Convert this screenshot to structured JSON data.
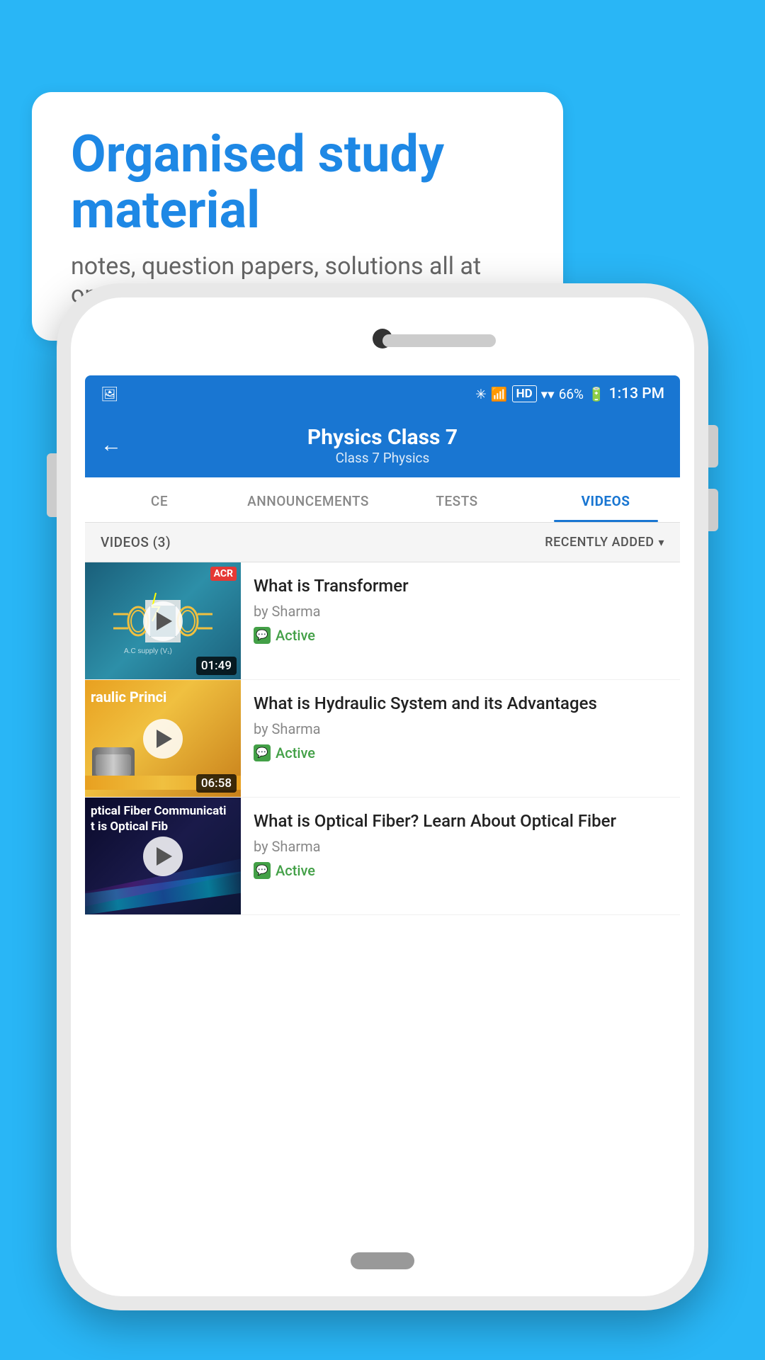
{
  "bubble": {
    "title": "Organised study material",
    "subtitle": "notes, question papers, solutions all at one place"
  },
  "statusBar": {
    "time": "1:13 PM",
    "battery": "66%",
    "signal": "HD"
  },
  "header": {
    "title": "Physics Class 7",
    "breadcrumb": "Class 7   Physics",
    "back_label": "←"
  },
  "tabs": [
    {
      "label": "CE",
      "active": false
    },
    {
      "label": "ANNOUNCEMENTS",
      "active": false
    },
    {
      "label": "TESTS",
      "active": false
    },
    {
      "label": "VIDEOS",
      "active": true
    }
  ],
  "toolbar": {
    "count_label": "VIDEOS (3)",
    "sort_label": "RECENTLY ADDED",
    "sort_icon": "▾"
  },
  "videos": [
    {
      "title": "What is  Transformer",
      "author": "by Sharma",
      "status": "Active",
      "duration": "01:49",
      "badge": "ACR"
    },
    {
      "title": "What is Hydraulic System and its Advantages",
      "author": "by Sharma",
      "status": "Active",
      "duration": "06:58"
    },
    {
      "title": "What is Optical Fiber? Learn About Optical Fiber",
      "author": "by Sharma",
      "status": "Active",
      "duration": ""
    }
  ]
}
